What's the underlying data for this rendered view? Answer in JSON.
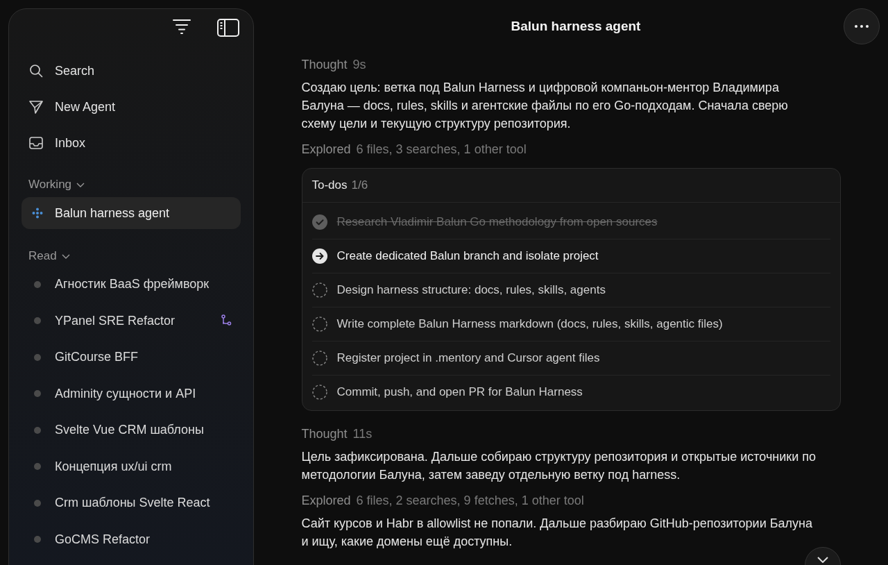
{
  "sidebar": {
    "nav": [
      {
        "kind": "search",
        "label": "Search"
      },
      {
        "kind": "new-agent",
        "label": "New Agent"
      },
      {
        "kind": "inbox",
        "label": "Inbox"
      }
    ],
    "sections": [
      {
        "title": "Working",
        "expanded": true,
        "items": [
          {
            "kind": "running",
            "label": "Balun harness agent",
            "selected": true,
            "branch": false
          }
        ]
      },
      {
        "title": "Read",
        "expanded": true,
        "items": [
          {
            "kind": "idle",
            "label": "Агностик BaaS фреймворк",
            "selected": false,
            "branch": false
          },
          {
            "kind": "idle",
            "label": "YPanel SRE Refactor",
            "selected": false,
            "branch": true
          },
          {
            "kind": "idle",
            "label": "GitCourse BFF",
            "selected": false,
            "branch": false
          },
          {
            "kind": "idle",
            "label": "Adminity сущности и API",
            "selected": false,
            "branch": false
          },
          {
            "kind": "idle",
            "label": "Svelte Vue CRM шаблоны",
            "selected": false,
            "branch": false
          },
          {
            "kind": "idle",
            "label": "Концепция ux/ui crm",
            "selected": false,
            "branch": false
          },
          {
            "kind": "idle",
            "label": "Crm шаблоны Svelte React",
            "selected": false,
            "branch": false
          },
          {
            "kind": "idle",
            "label": "GoCMS Refactor",
            "selected": false,
            "branch": false
          }
        ]
      }
    ]
  },
  "header": {
    "title": "Balun harness agent"
  },
  "blocks": [
    {
      "kind": "meta",
      "label": "Thought",
      "detail": "9s"
    },
    {
      "kind": "text",
      "text": "Создаю цель: ветка под Balun Harness и цифровой компаньон-ментор Владимира Балуна — docs, rules, skills и агентские файлы по его Go-подходам. Сначала сверю схему цели и текущую структуру репозитория."
    },
    {
      "kind": "meta",
      "label": "Explored",
      "detail": "6 files, 3 searches, 1 other tool"
    },
    {
      "kind": "todos",
      "title": "To-dos",
      "count": "1/6",
      "items": [
        {
          "kind": "done",
          "label": "Research Vladimir Balun Go methodology from open sources"
        },
        {
          "kind": "active",
          "label": "Create dedicated Balun branch and isolate project"
        },
        {
          "kind": "pending",
          "label": "Design harness structure: docs, rules, skills, agents"
        },
        {
          "kind": "pending",
          "label": "Write complete Balun Harness markdown (docs, rules, skills, agentic files)"
        },
        {
          "kind": "pending",
          "label": "Register project in .mentory and Cursor agent files"
        },
        {
          "kind": "pending",
          "label": "Commit, push, and open PR for Balun Harness"
        }
      ]
    },
    {
      "kind": "meta",
      "label": "Thought",
      "detail": "11s"
    },
    {
      "kind": "text",
      "text": "Цель зафиксирована. Дальше собираю структуру репозитория и открытые источники по методологии Балуна, затем заведу отдельную ветку под harness."
    },
    {
      "kind": "meta",
      "label": "Explored",
      "detail": "6 files, 2 searches, 9 fetches, 1 other tool"
    },
    {
      "kind": "text",
      "text": "Сайт курсов и Habr в allowlist не попали. Дальше разбираю GitHub-репозитории Балуна и ищу, какие домены ещё доступны."
    }
  ]
}
